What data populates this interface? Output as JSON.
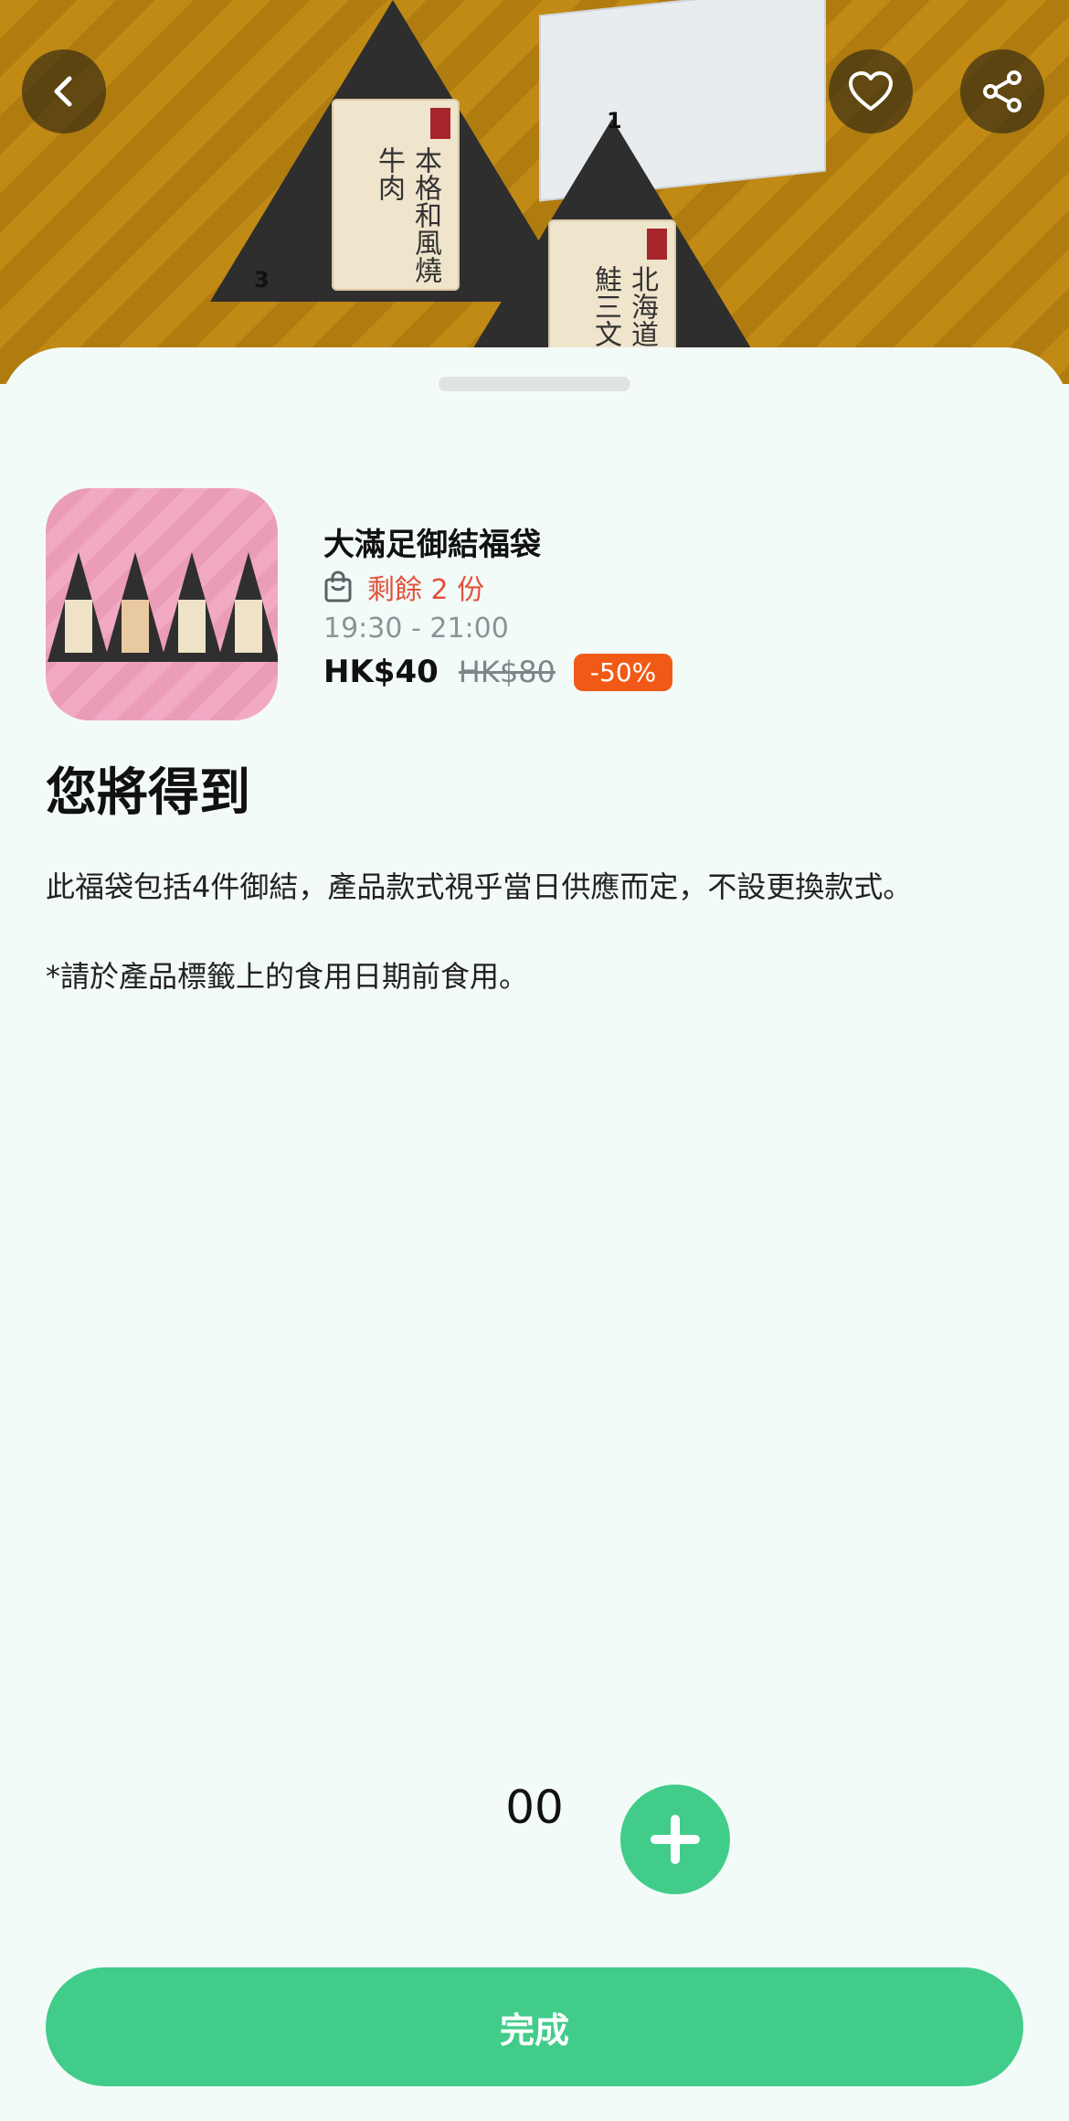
{
  "header": {
    "back_icon": "chevron-left-icon",
    "favorite_icon": "heart-icon",
    "share_icon": "share-icon"
  },
  "hero": {
    "onigiri_left_label": "本格和風燒牛肉",
    "onigiri_left_number": "3",
    "onigiri_right_label": "北海道產秋鮭三文魚",
    "onigiri_right_number": "1"
  },
  "product": {
    "name": "大滿足御結福袋",
    "stock_text": "剩餘 2 份",
    "time_range": "19:30 - 21:00",
    "price": "HK$40",
    "original_price": "HK$80",
    "discount": "-50%"
  },
  "section": {
    "title": "您將得到",
    "description": "此福袋包括4件御結，產品款式視乎當日供應而定，不設更換款式。",
    "note": "*請於產品標籤上的食用日期前食用。"
  },
  "quantity": {
    "value": "00"
  },
  "footer": {
    "done_label": "完成"
  },
  "colors": {
    "accent": "#41cc8a",
    "stock_red": "#e2503b",
    "discount_orange": "#f05a16",
    "sheet_bg": "#f3fbf8"
  }
}
